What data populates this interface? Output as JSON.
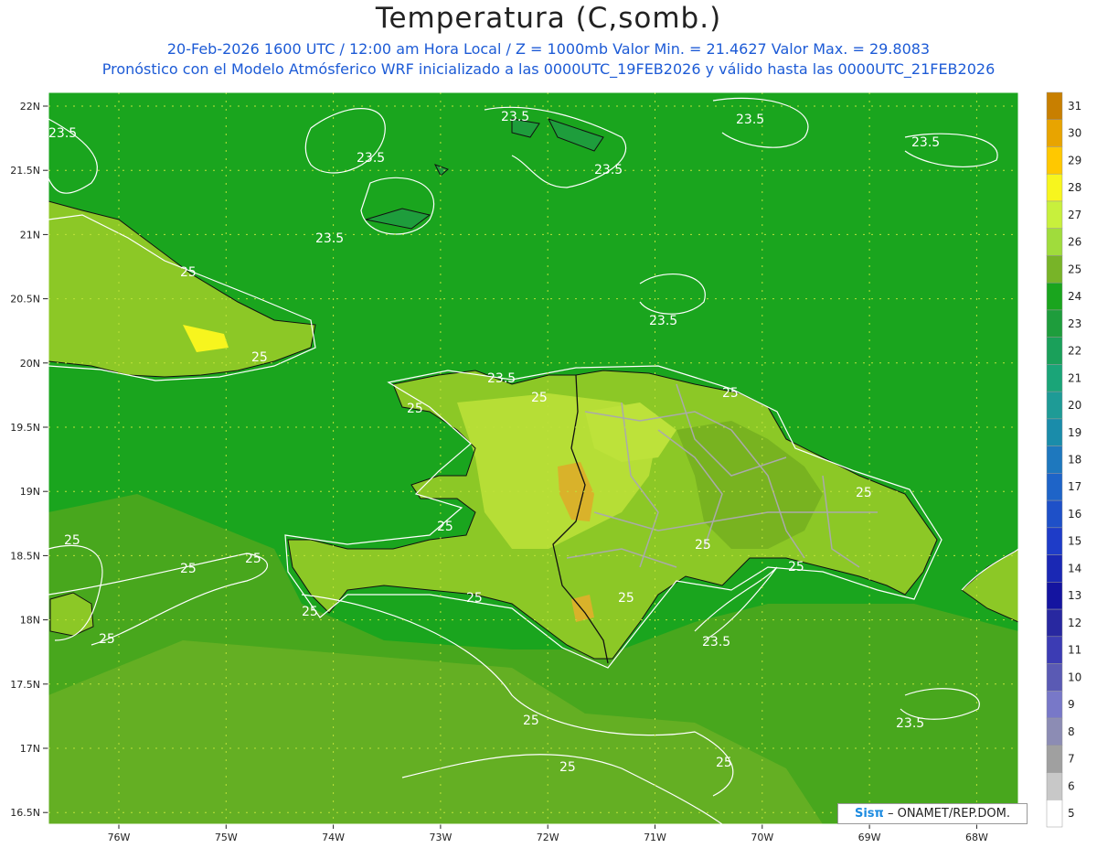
{
  "title": "Temperatura (C,somb.)",
  "subtitle1": "20-Feb-2026 1600 UTC / 12:00 am Hora Local / Z = 1000mb   Valor Min. = 21.4627   Valor Max. = 29.8083",
  "subtitle2": "Pronóstico con el Modelo Atmósferico WRF inicializado a las 0000UTC_19FEB2026 y válido hasta las  0000UTC_21FEB2026",
  "credit": {
    "logo": "Sisπ",
    "text": "– ONAMET/REP.DOM."
  },
  "colors": {
    "ocean": "#1aa51e",
    "land_low": "#6faa1e",
    "land_mid": "#8cc826",
    "land_high": "#bde23a",
    "hot": "#d9b22a",
    "contour": "#ffffff",
    "border": "#aaaaaa",
    "coast": "#111111"
  },
  "lat_labels": [
    "22N",
    "21.5N",
    "21N",
    "20.5N",
    "20N",
    "19.5N",
    "19N",
    "18.5N",
    "18N",
    "17.5N",
    "17N",
    "16.5N"
  ],
  "lon_labels": [
    "76W",
    "75W",
    "74W",
    "73W",
    "72W",
    "71W",
    "70W",
    "69W",
    "68W"
  ],
  "colorbar": {
    "levels": [
      "31",
      "30",
      "29",
      "28",
      "27",
      "26",
      "25",
      "24",
      "23",
      "22",
      "21",
      "20",
      "19",
      "18",
      "17",
      "16",
      "15",
      "14",
      "13",
      "12",
      "11",
      "10",
      "9",
      "8",
      "7",
      "6",
      "5"
    ],
    "colors": [
      "#c87f00",
      "#e8a400",
      "#ffc800",
      "#f7f51e",
      "#c8f03c",
      "#a0dc3c",
      "#78b428",
      "#1aa51e",
      "#1e9d3c",
      "#1aa05a",
      "#1aa578",
      "#1e9b96",
      "#1a8caa",
      "#1e78be",
      "#1e64c8",
      "#1e50c8",
      "#1e3cc8",
      "#1a28b4",
      "#1414a0",
      "#2828a0",
      "#3c3cb4",
      "#5a5ab4",
      "#7878c8",
      "#8c8cb4",
      "#a0a0a0",
      "#c8c8c8",
      "#ffffff"
    ]
  },
  "contour_labels": [
    {
      "text": "23.5"
    },
    {
      "text": "23.5"
    },
    {
      "text": "23.5"
    },
    {
      "text": "23.5"
    },
    {
      "text": "23.5"
    },
    {
      "text": "23.5"
    },
    {
      "text": "23.5"
    },
    {
      "text": "23.5"
    },
    {
      "text": "23.5"
    },
    {
      "text": "23.5"
    },
    {
      "text": "23.5"
    },
    {
      "text": "25"
    },
    {
      "text": "25"
    },
    {
      "text": "25"
    },
    {
      "text": "25"
    },
    {
      "text": "25"
    },
    {
      "text": "25"
    },
    {
      "text": "25"
    },
    {
      "text": "25"
    },
    {
      "text": "25"
    },
    {
      "text": "25"
    },
    {
      "text": "25"
    },
    {
      "text": "25"
    },
    {
      "text": "25"
    },
    {
      "text": "25"
    },
    {
      "text": "25"
    },
    {
      "text": "25"
    },
    {
      "text": "25"
    },
    {
      "text": "25"
    },
    {
      "text": "25"
    }
  ]
}
